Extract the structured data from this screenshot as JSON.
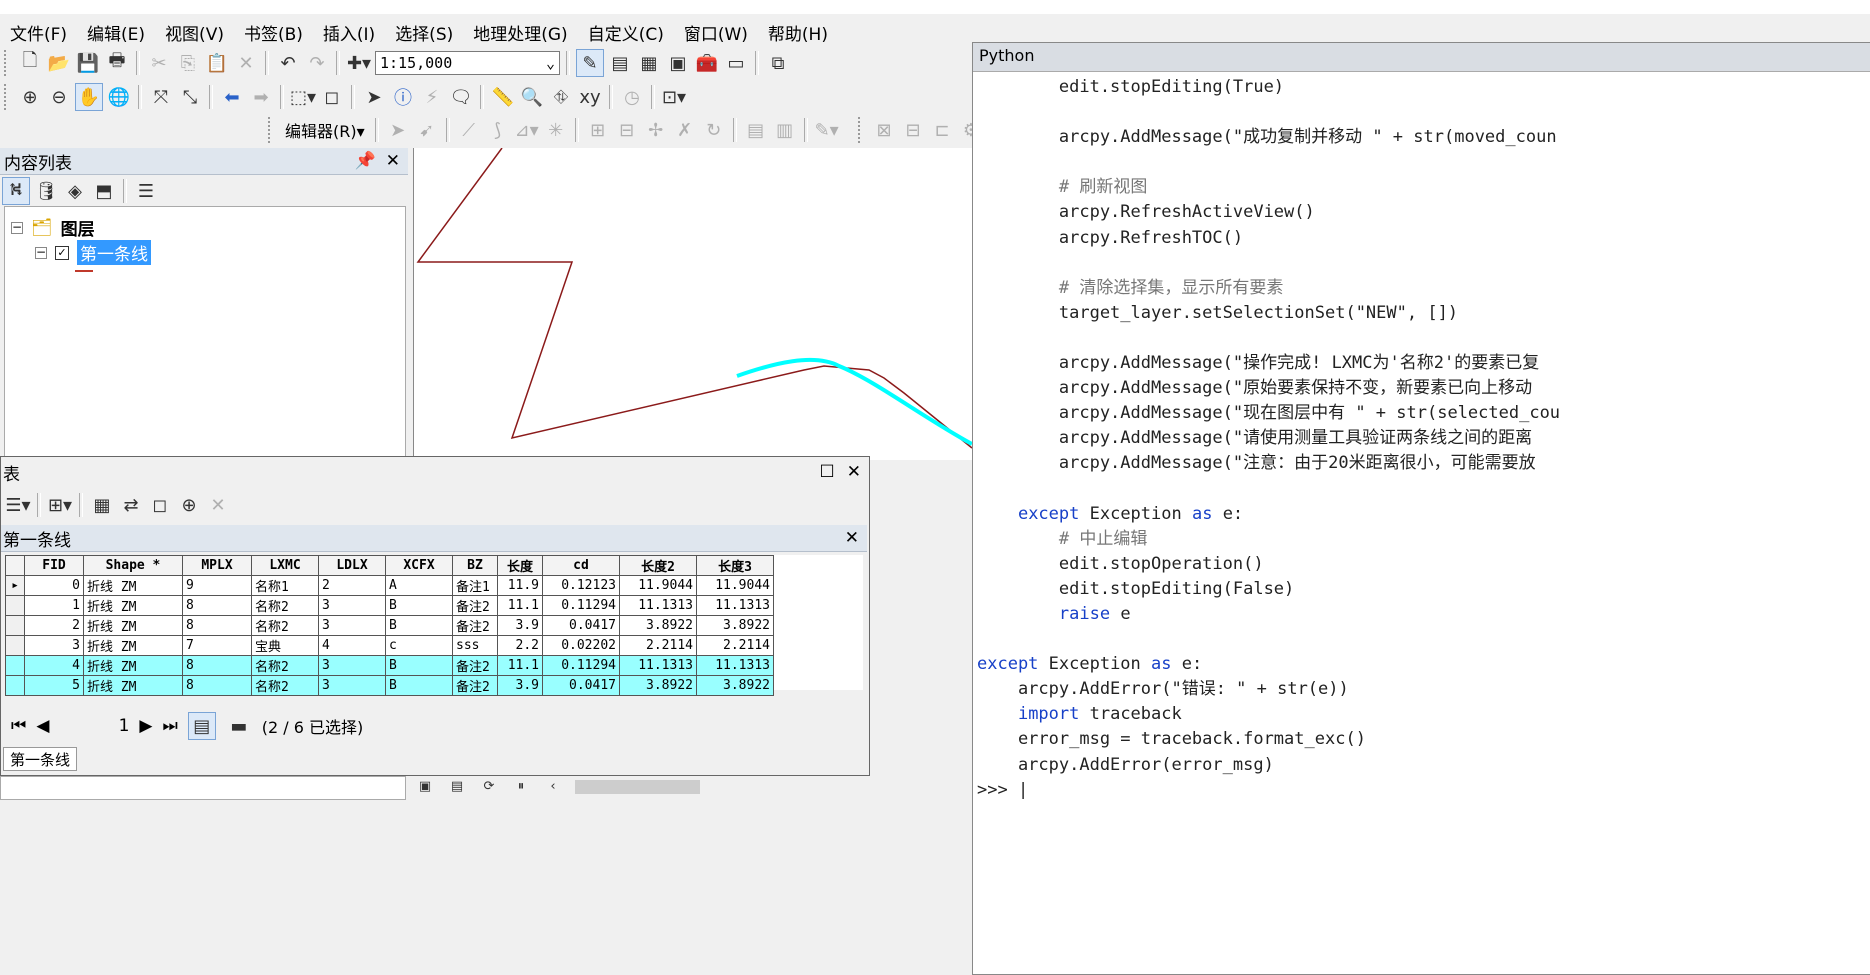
{
  "menu": [
    "文件(F)",
    "编辑(E)",
    "视图(V)",
    "书签(B)",
    "插入(I)",
    "选择(S)",
    "地理处理(G)",
    "自定义(C)",
    "窗口(W)",
    "帮助(H)"
  ],
  "toolbar": {
    "scale": "1:15,000",
    "editor_label": "编辑器(R)▾"
  },
  "toc": {
    "title": "内容列表",
    "root_label": "图层",
    "layer_label": "第一条线",
    "legend_color": "#c0392b"
  },
  "table_window": {
    "title": "表",
    "tab_title": "第一条线",
    "columns": [
      "FID",
      "Shape *",
      "MPLX",
      "LXMC",
      "LDLX",
      "XCFX",
      "BZ",
      "长度",
      "cd",
      "长度2",
      "长度3"
    ],
    "rows": [
      {
        "selected": false,
        "current": true,
        "cells": [
          "0",
          "折线 ZM",
          "9",
          "名称1",
          "2",
          "A",
          "备注1",
          "11.9",
          "0.12123",
          "11.9044",
          "11.9044"
        ]
      },
      {
        "selected": false,
        "current": false,
        "cells": [
          "1",
          "折线 ZM",
          "8",
          "名称2",
          "3",
          "B",
          "备注2",
          "11.1",
          "0.11294",
          "11.1313",
          "11.1313"
        ]
      },
      {
        "selected": false,
        "current": false,
        "cells": [
          "2",
          "折线 ZM",
          "8",
          "名称2",
          "3",
          "B",
          "备注2",
          "3.9",
          "0.0417",
          "3.8922",
          "3.8922"
        ]
      },
      {
        "selected": false,
        "current": false,
        "cells": [
          "3",
          "折线 ZM",
          "7",
          "宝典",
          "4",
          "c",
          "sss",
          "2.2",
          "0.02202",
          "2.2114",
          "2.2114"
        ]
      },
      {
        "selected": true,
        "current": false,
        "cells": [
          "4",
          "折线 ZM",
          "8",
          "名称2",
          "3",
          "B",
          "备注2",
          "11.1",
          "0.11294",
          "11.1313",
          "11.1313"
        ]
      },
      {
        "selected": true,
        "current": false,
        "cells": [
          "5",
          "折线 ZM",
          "8",
          "名称2",
          "3",
          "B",
          "备注2",
          "3.9",
          "0.0417",
          "3.8922",
          "3.8922"
        ]
      }
    ],
    "record_number": "1",
    "selection_status": "(2 / 6 已选择)",
    "bottom_tab": "第一条线"
  },
  "python": {
    "title": "Python",
    "prompt": ">>> |"
  },
  "colors": {
    "selected_row": "#99ffff",
    "highlight": "#00ffff",
    "line": "#8b1a1a",
    "toc_selected": "#3399ff"
  }
}
